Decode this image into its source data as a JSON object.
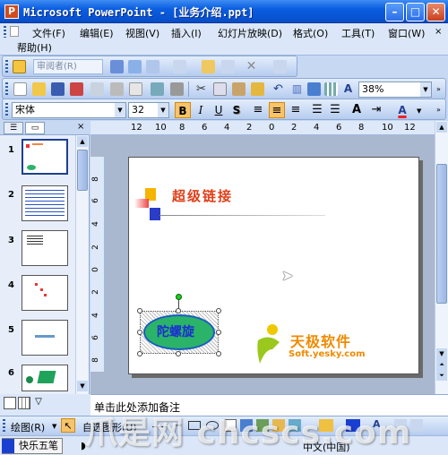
{
  "window": {
    "title": "Microsoft PowerPoint - [业务介绍.ppt]",
    "app_icon": "powerpoint-app-icon",
    "icon_label": "P"
  },
  "menu": {
    "items": [
      "文件(F)",
      "编辑(E)",
      "视图(V)",
      "插入(I)",
      "幻灯片放映(D)",
      "格式(O)",
      "工具(T)",
      "窗口(W)"
    ],
    "row2": [
      "帮助(H)"
    ]
  },
  "review_toolbar": {
    "label": "审阅者(R)"
  },
  "standard_toolbar": {
    "zoom": "38%"
  },
  "format_toolbar": {
    "font": "宋体",
    "size": "32",
    "bold": "B",
    "italic": "I",
    "underline": "U",
    "shadow": "S",
    "font_color_label": "A",
    "grow_font": "A"
  },
  "left_panel": {
    "tabs": [
      "outline-tab",
      "slides-tab"
    ],
    "slide_numbers": [
      "1",
      "2",
      "3",
      "4",
      "5",
      "6"
    ]
  },
  "ruler": {
    "h_labels": [
      "12",
      "10",
      "8",
      "6",
      "4",
      "2",
      "0",
      "2",
      "4",
      "6",
      "8",
      "10",
      "12"
    ],
    "v_labels": [
      "8",
      "6",
      "4",
      "2",
      "0",
      "2",
      "4",
      "6",
      "8"
    ]
  },
  "slide": {
    "title": "超级链接",
    "button_text": "陀螺旋",
    "logo_text": "天极软件",
    "logo_url": "Soft.yesky.com"
  },
  "notes": {
    "placeholder": "单击此处添加备注"
  },
  "drawing_toolbar": {
    "draw_label": "绘图(R)",
    "autoshapes_label": "自选图形(U)"
  },
  "status": {
    "ime": "快乐五笔",
    "language": "中文(中国)",
    "watermark": "爪是网 chcscs.com"
  },
  "colors": {
    "title_bar": "#0a5ee0",
    "accent": "#c7d8f2",
    "slide_title": "#e0401a",
    "ellipse": "#2bb36a",
    "ellipse_text": "#1a2fd0"
  }
}
